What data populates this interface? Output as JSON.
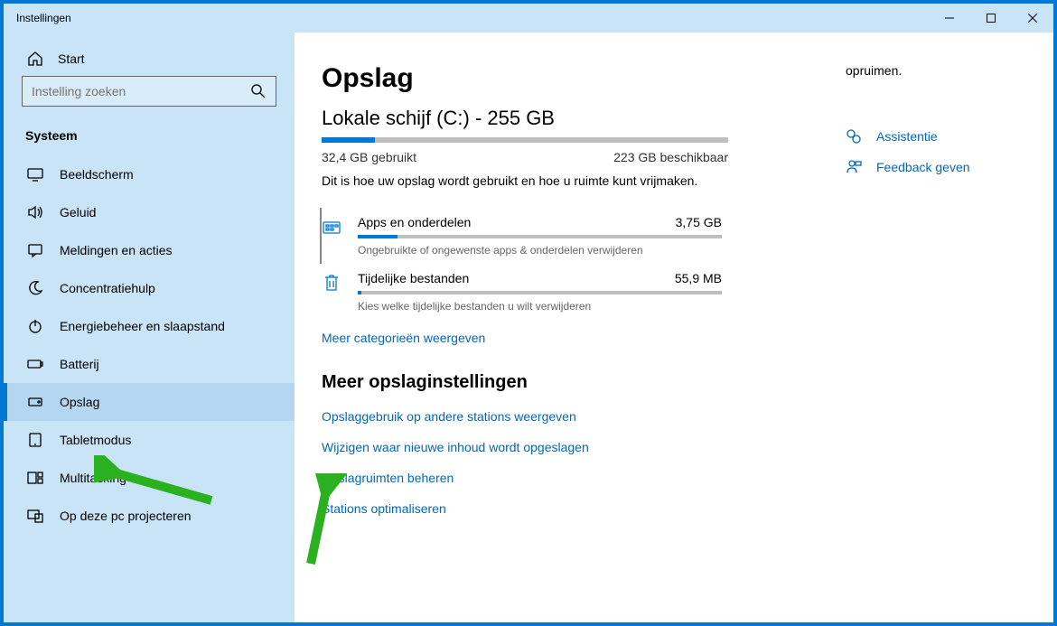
{
  "window": {
    "title": "Instellingen"
  },
  "sidebar": {
    "home": "Start",
    "search_placeholder": "Instelling zoeken",
    "section": "Systeem",
    "items": [
      {
        "label": "Beeldscherm"
      },
      {
        "label": "Geluid"
      },
      {
        "label": "Meldingen en acties"
      },
      {
        "label": "Concentratiehulp"
      },
      {
        "label": "Energiebeheer en slaapstand"
      },
      {
        "label": "Batterij"
      },
      {
        "label": "Opslag"
      },
      {
        "label": "Tabletmodus"
      },
      {
        "label": "Multitasking"
      },
      {
        "label": "Op deze pc projecteren"
      }
    ]
  },
  "page": {
    "title": "Opslag",
    "disk_title": "Lokale schijf (C:) - 255 GB",
    "used": "32,4 GB gebruikt",
    "free": "223 GB beschikbaar",
    "desc": "Dit is hoe uw opslag wordt gebruikt en hoe u ruimte kunt vrijmaken.",
    "categories": [
      {
        "name": "Apps en onderdelen",
        "size": "3,75 GB",
        "sub": "Ongebruikte of ongewenste apps & onderdelen verwijderen",
        "pct": 11
      },
      {
        "name": "Tijdelijke bestanden",
        "size": "55,9 MB",
        "sub": "Kies welke tijdelijke bestanden u wilt verwijderen",
        "pct": 1
      }
    ],
    "show_more": "Meer categorieën weergeven",
    "more_heading": "Meer opslaginstellingen",
    "links": [
      "Opslaggebruik op andere stations weergeven",
      "Wijzigen waar nieuwe inhoud wordt opgeslagen",
      "Opslagruimten beheren",
      "Stations optimaliseren"
    ]
  },
  "right": {
    "cleanup": "opruimen.",
    "help": "Assistentie",
    "feedback": "Feedback geven"
  }
}
